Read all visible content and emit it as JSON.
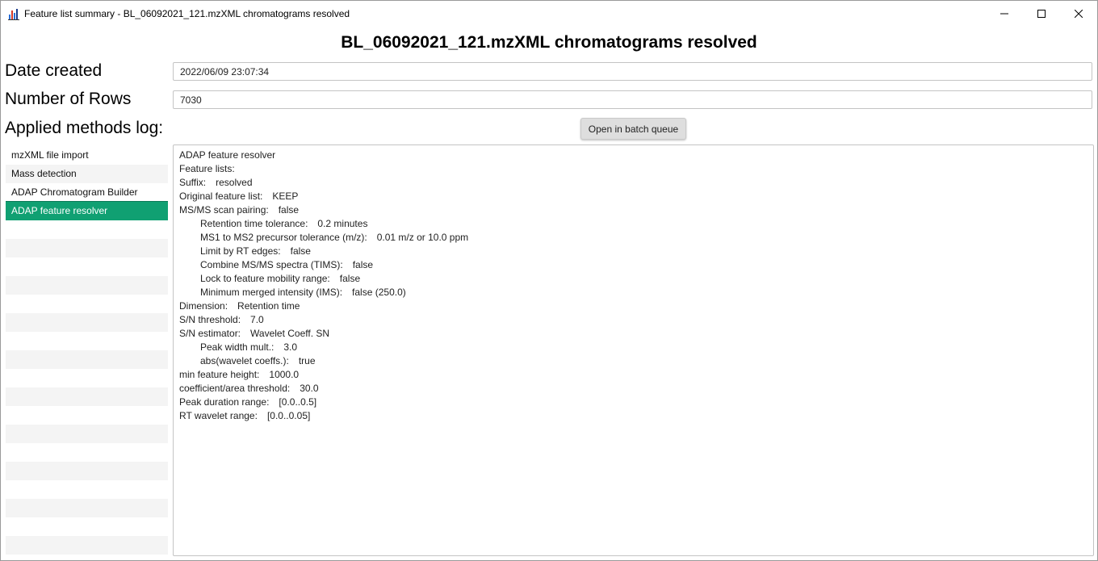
{
  "window": {
    "title": "Feature list summary - BL_06092021_121.mzXML chromatograms resolved",
    "controls": {
      "minimize": "minimize",
      "maximize": "maximize",
      "close": "close"
    }
  },
  "heading": "BL_06092021_121.mzXML chromatograms resolved",
  "fields": {
    "date_created_label": "Date created",
    "date_created_value": "2022/06/09 23:07:34",
    "number_of_rows_label": "Number of Rows",
    "number_of_rows_value": "7030",
    "methods_log_label": "Applied methods log:"
  },
  "batch_button_label": "Open in batch queue",
  "methods": [
    {
      "label": "mzXML file import",
      "selected": false
    },
    {
      "label": "Mass detection",
      "selected": false
    },
    {
      "label": "ADAP Chromatogram Builder",
      "selected": false
    },
    {
      "label": "ADAP feature resolver",
      "selected": true
    }
  ],
  "details": [
    {
      "key": "ADAP feature resolver",
      "value": "",
      "indent": false
    },
    {
      "key": "Feature lists:",
      "value": "",
      "indent": false
    },
    {
      "key": "Suffix:",
      "value": "resolved",
      "indent": false
    },
    {
      "key": "Original feature list:",
      "value": "KEEP",
      "indent": false
    },
    {
      "key": "MS/MS scan pairing:",
      "value": "false",
      "indent": false
    },
    {
      "key": "Retention time tolerance:",
      "value": "0.2 minutes",
      "indent": true
    },
    {
      "key": "MS1 to MS2 precursor tolerance (m/z):",
      "value": "0.01 m/z or 10.0 ppm",
      "indent": true
    },
    {
      "key": "Limit by RT edges:",
      "value": "false",
      "indent": true
    },
    {
      "key": "Combine MS/MS spectra (TIMS):",
      "value": "false",
      "indent": true
    },
    {
      "key": "Lock to feature mobility range:",
      "value": "false",
      "indent": true
    },
    {
      "key": "Minimum merged intensity (IMS):",
      "value": "false (250.0)",
      "indent": true
    },
    {
      "key": "Dimension:",
      "value": "Retention time",
      "indent": false
    },
    {
      "key": "S/N threshold:",
      "value": "7.0",
      "indent": false
    },
    {
      "key": "S/N estimator:",
      "value": "Wavelet Coeff. SN",
      "indent": false
    },
    {
      "key": "Peak width mult.:",
      "value": "3.0",
      "indent": true
    },
    {
      "key": "abs(wavelet coeffs.):",
      "value": "true",
      "indent": true
    },
    {
      "key": "min feature height:",
      "value": "1000.0",
      "indent": false
    },
    {
      "key": "coefficient/area threshold:",
      "value": "30.0",
      "indent": false
    },
    {
      "key": "Peak duration range:",
      "value": "[0.0..0.5]",
      "indent": false
    },
    {
      "key": "RT wavelet range:",
      "value": "[0.0..0.05]",
      "indent": false
    }
  ],
  "colors": {
    "selected_row": "#10a072",
    "row_stripe": "#f4f4f4"
  }
}
